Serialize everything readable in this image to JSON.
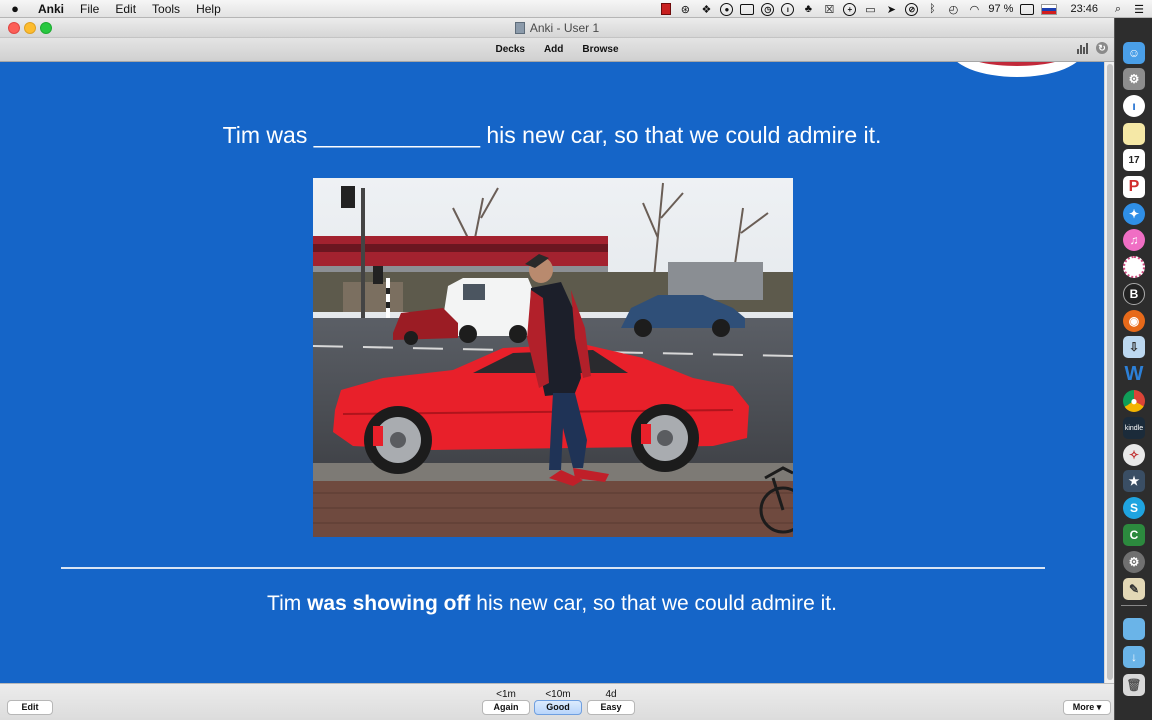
{
  "menubar": {
    "app_name": "Anki",
    "menus": [
      "File",
      "Edit",
      "Tools",
      "Help"
    ],
    "battery": "97 %",
    "clock": "23:46"
  },
  "window": {
    "title": "Anki - User 1"
  },
  "toolbar": {
    "decks": "Decks",
    "add": "Add",
    "browse": "Browse"
  },
  "card": {
    "question": "Tim was _____________ his new car, so that we could admire it.",
    "answer_before": "Tim ",
    "answer_bold": "was showing off",
    "answer_after": " his new car, so that we could admire it."
  },
  "bottombar": {
    "edit": "Edit",
    "more": "More ▾",
    "again_interval": "<1m",
    "again": "Again",
    "good_interval": "<10m",
    "good": "Good",
    "easy_interval": "4d",
    "easy": "Easy"
  },
  "dock": {
    "calendar_day": "17",
    "kindle_label": "kindle"
  },
  "colors": {
    "card_background": "#1565c8",
    "car_red": "#e8202a"
  }
}
